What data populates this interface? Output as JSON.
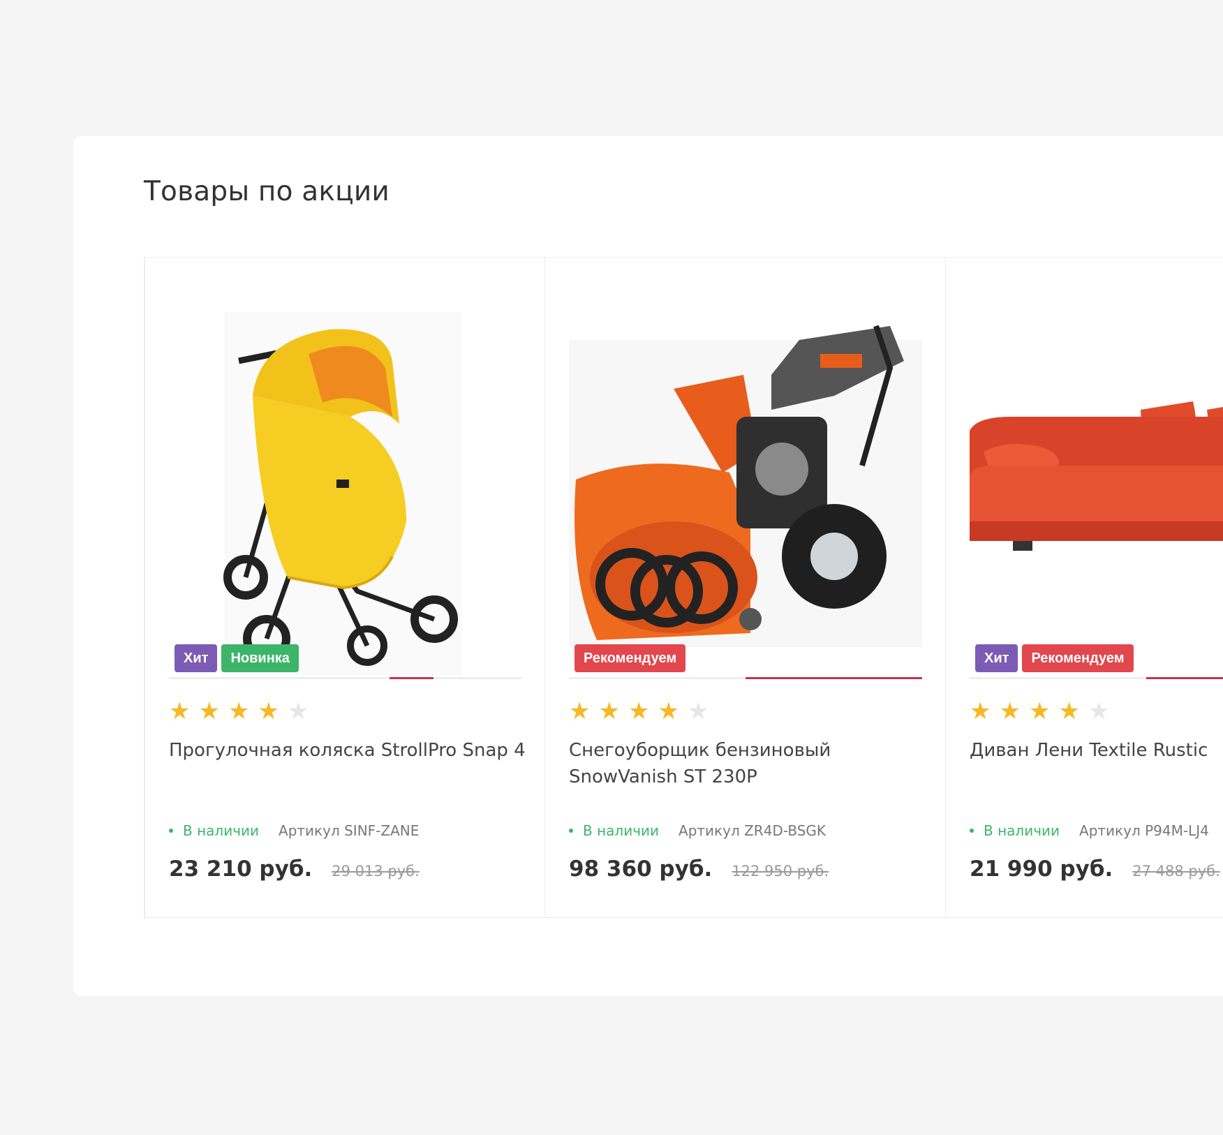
{
  "section": {
    "title": "Товары по акции"
  },
  "products": [
    {
      "image": "stroller-image",
      "badges": [
        {
          "label": "Хит",
          "kind": "hit"
        },
        {
          "label": "Новинка",
          "kind": "new"
        }
      ],
      "rating": 4,
      "rating_max": 5,
      "name": "Прогулочная коляска StrollPro Snap 4",
      "stock": "В наличии",
      "sku": "Артикул SINF-ZANE",
      "price": "23 210 руб.",
      "old_price": "29 013 руб."
    },
    {
      "image": "snowblower-image",
      "badges": [
        {
          "label": "Рекомендуем",
          "kind": "rec"
        }
      ],
      "rating": 4,
      "rating_max": 5,
      "name": "Снегоуборщик бензиновый SnowVanish ST 230P",
      "stock": "В наличии",
      "sku": "Артикул ZR4D-BSGK",
      "price": "98 360 руб.",
      "old_price": "122 950 руб."
    },
    {
      "image": "sofa-image",
      "badges": [
        {
          "label": "Хит",
          "kind": "hit"
        },
        {
          "label": "Рекомендуем",
          "kind": "rec"
        }
      ],
      "rating": 4,
      "rating_max": 5,
      "name": "Диван Лени Textile Rustic",
      "stock": "В наличии",
      "sku": "Артикул P94M-LJ4",
      "price": "21 990 руб.",
      "old_price": "27 488 руб."
    }
  ],
  "colors": {
    "badge_hit": "#7b5bb6",
    "badge_new": "#3cb56a",
    "badge_rec": "#e2474d",
    "star": "#f6b824",
    "in_stock": "#3cb56a",
    "slider_accent": "#c8334a"
  }
}
